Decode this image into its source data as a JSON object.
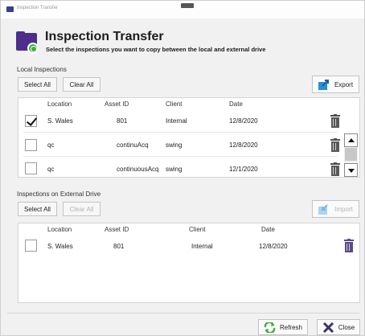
{
  "window": {
    "title": "Inspection Transfer",
    "icon": "app-icon"
  },
  "header": {
    "title": "Inspection Transfer",
    "subtitle": "Select the inspections you want to copy between the local and external drive",
    "icon": "folder-sync-icon"
  },
  "local": {
    "section_label": "Local Inspections",
    "select_all_label": "Select All",
    "clear_all_label": "Clear All",
    "export_label": "Export",
    "columns": [
      "Location",
      "Asset ID",
      "Client",
      "Date"
    ],
    "rows": [
      {
        "checked": true,
        "location": "S. Wales",
        "asset_id": "801",
        "client": "Internal",
        "date": "12/8/2020"
      },
      {
        "checked": false,
        "location": "qc",
        "asset_id": "continuAcq",
        "client": "swing",
        "date": "12/8/2020"
      },
      {
        "checked": false,
        "location": "qc",
        "asset_id": "continuousAcq",
        "client": "swing",
        "date": "12/1/2020"
      }
    ]
  },
  "external": {
    "section_label": "Inspections on External Drive",
    "select_all_label": "Select All",
    "clear_all_label": "Clear All",
    "import_label": "Import",
    "columns": [
      "Location",
      "Asset ID",
      "Client",
      "Date"
    ],
    "rows": [
      {
        "checked": false,
        "location": "S. Wales",
        "asset_id": "801",
        "client": "Internal",
        "date": "12/8/2020"
      }
    ]
  },
  "footer": {
    "refresh_label": "Refresh",
    "close_label": "Close"
  },
  "colors": {
    "accent_purple": "#4b2f8a",
    "accent_green": "#3fae3a",
    "export_blue": "#2a8fd6",
    "close_x": "#3a3570"
  }
}
